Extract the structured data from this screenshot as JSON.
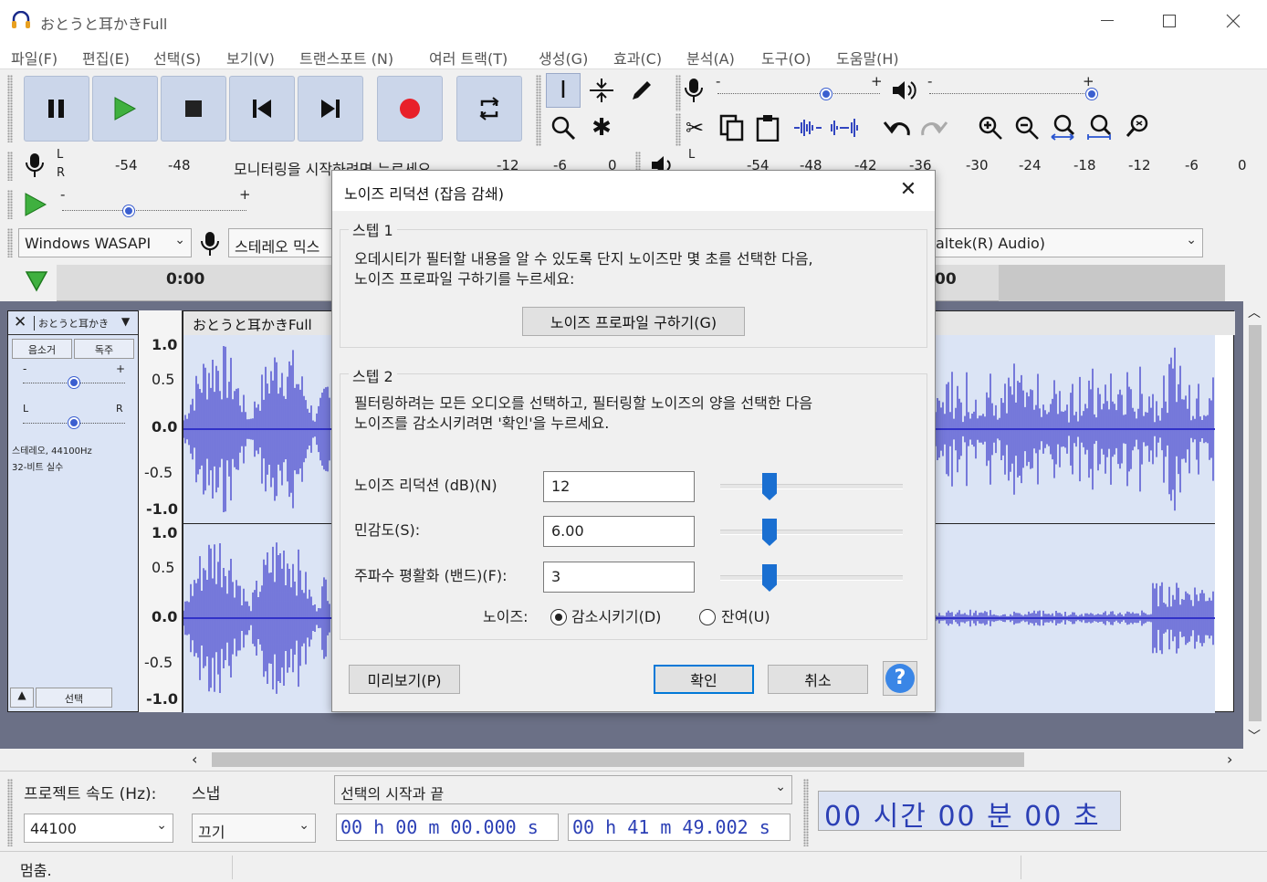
{
  "window": {
    "title": "おとうと耳かきFull"
  },
  "menu": [
    "파일(F)",
    "편집(E)",
    "선택(S)",
    "보기(V)",
    "트랜스포트 (N)",
    "여러 트랙(T)",
    "생성(G)",
    "효과(C)",
    "분석(A)",
    "도구(O)",
    "도움말(H)"
  ],
  "meters": {
    "record_ticks": [
      "-54",
      "-48",
      "-12",
      "-6",
      "0"
    ],
    "record_message": "모니터링을 시작하려면 누르세요",
    "play_ticks": [
      "-54",
      "-48",
      "-42",
      "-36",
      "-30",
      "-24",
      "-18",
      "-12",
      "-6",
      "0"
    ],
    "l": "L",
    "r": "R"
  },
  "device": {
    "host": "Windows WASAPI",
    "record_device": "스테레오 믹스",
    "play_device": "altek(R) Audio)"
  },
  "timeline": {
    "start": "0:00",
    "right_label": "00"
  },
  "track": {
    "name": "おとうと耳かき",
    "clip_name": "おとうと耳かきFull",
    "mute": "음소거",
    "solo": "독주",
    "gain_minus": "-",
    "gain_plus": "+",
    "pan_l": "L",
    "pan_r": "R",
    "info": "스테레오, 44100Hz",
    "format": "32-비트 실수",
    "select": "선택",
    "ruler": [
      "1.0",
      "0.5",
      "0.0",
      "-0.5",
      "-1.0",
      "1.0",
      "0.5",
      "0.0",
      "-0.5",
      "-1.0"
    ]
  },
  "bottom": {
    "rate_label": "프로젝트 속도 (Hz):",
    "snap_label": "스냅",
    "rate_value": "44100",
    "snap_value": "끄기",
    "selection_mode": "선택의 시작과 끝",
    "start_time": "00 h 00 m 00.000 s",
    "end_time": "00 h 41 m 49.002 s",
    "big_time": "00 시간 00 분 00 초"
  },
  "status": {
    "text": "멈춤."
  },
  "dialog": {
    "title": "노이즈 리덕션 (잡음 감쇄)",
    "step1_legend": "스텝 1",
    "step1_text_1": "오데시티가 필터할 내용을 알 수 있도록 단지 노이즈만 몇 초를 선택한 다음,",
    "step1_text_2": "노이즈 프로파일 구하기를 누르세요:",
    "profile_button": "노이즈 프로파일 구하기(G)",
    "step2_legend": "스텝 2",
    "step2_text_1": "필터링하려는 모든 오디오를 선택하고, 필터링할 노이즈의 양을 선택한 다음",
    "step2_text_2": "노이즈를 감소시키려면 '확인'을 누르세요.",
    "reduction_label": "노이즈 리덕션 (dB)(N)",
    "reduction_value": "12",
    "sensitivity_label": "민감도(S):",
    "sensitivity_value": "6.00",
    "smoothing_label": "주파수 평활화 (밴드)(F):",
    "smoothing_value": "3",
    "noise_label": "노이즈:",
    "radio_reduce": "감소시키기(D)",
    "radio_residue": "잔여(U)",
    "preview_button": "미리보기(P)",
    "ok_button": "확인",
    "cancel_button": "취소",
    "help_glyph": "?",
    "close_glyph": "✕"
  },
  "slider_levels": {
    "reduction": 0.27,
    "sensitivity": 0.27,
    "smoothing": 0.27,
    "record_volume": 0.67,
    "play_volume": 1.0,
    "play_speed": 0.36
  },
  "colors": {
    "accent": "#3b5fd0",
    "wave": "#3232c8",
    "button_blue": "#cbd6ea"
  }
}
